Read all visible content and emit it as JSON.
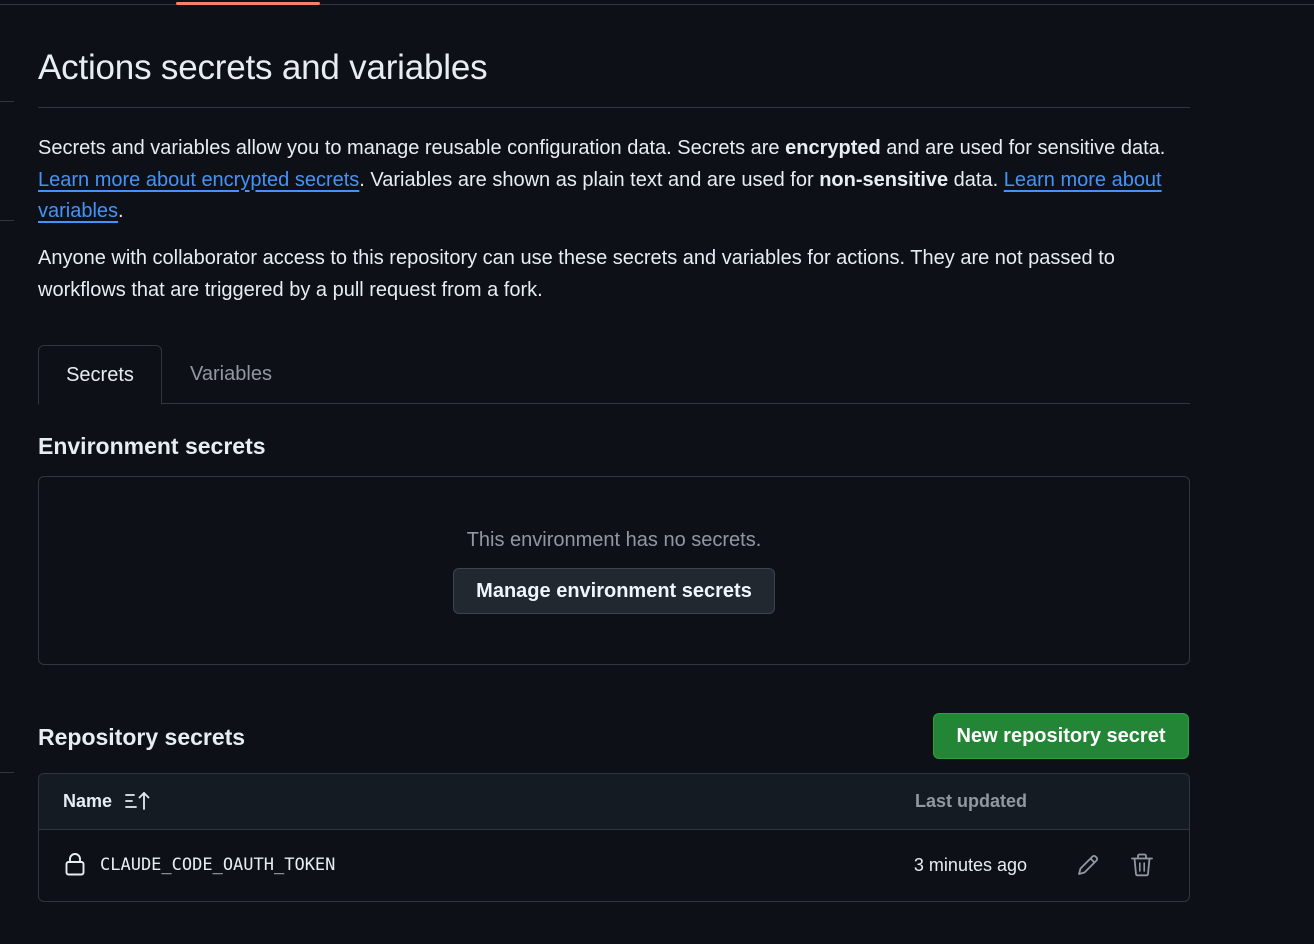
{
  "page": {
    "title": "Actions secrets and variables"
  },
  "intro": {
    "p1_part1": "Secrets and variables allow you to manage reusable configuration data. Secrets are ",
    "p1_bold1": "encrypted",
    "p1_part2": " and are used for sensitive data. ",
    "p1_link1": "Learn more about encrypted secrets",
    "p1_part3": ". Variables are shown as plain text and are used for ",
    "p1_bold2": "non-sensitive",
    "p1_part4": " data. ",
    "p1_link2": "Learn more about variables",
    "p1_part5": ".",
    "p2": "Anyone with collaborator access to this repository can use these secrets and variables for actions. They are not passed to workflows that are triggered by a pull request from a fork."
  },
  "tabs": [
    {
      "label": "Secrets",
      "active": true
    },
    {
      "label": "Variables",
      "active": false
    }
  ],
  "environment_secrets": {
    "heading": "Environment secrets",
    "empty_text": "This environment has no secrets.",
    "manage_button": "Manage environment secrets"
  },
  "repository_secrets": {
    "heading": "Repository secrets",
    "new_button": "New repository secret",
    "columns": {
      "name": "Name",
      "last_updated": "Last updated"
    },
    "sort_icon": "sort-ascending-icon",
    "rows": [
      {
        "icon": "lock-icon",
        "name": "CLAUDE_CODE_OAUTH_TOKEN",
        "last_updated": "3 minutes ago",
        "actions": [
          "pencil-icon",
          "trash-icon"
        ]
      }
    ]
  },
  "colors": {
    "background": "#0d1117",
    "text": "#e6edf3",
    "muted": "#9198a1",
    "border": "#30363d",
    "link": "#4493f8",
    "primary_button": "#238636",
    "tab_underline_accent": "#f78166"
  }
}
